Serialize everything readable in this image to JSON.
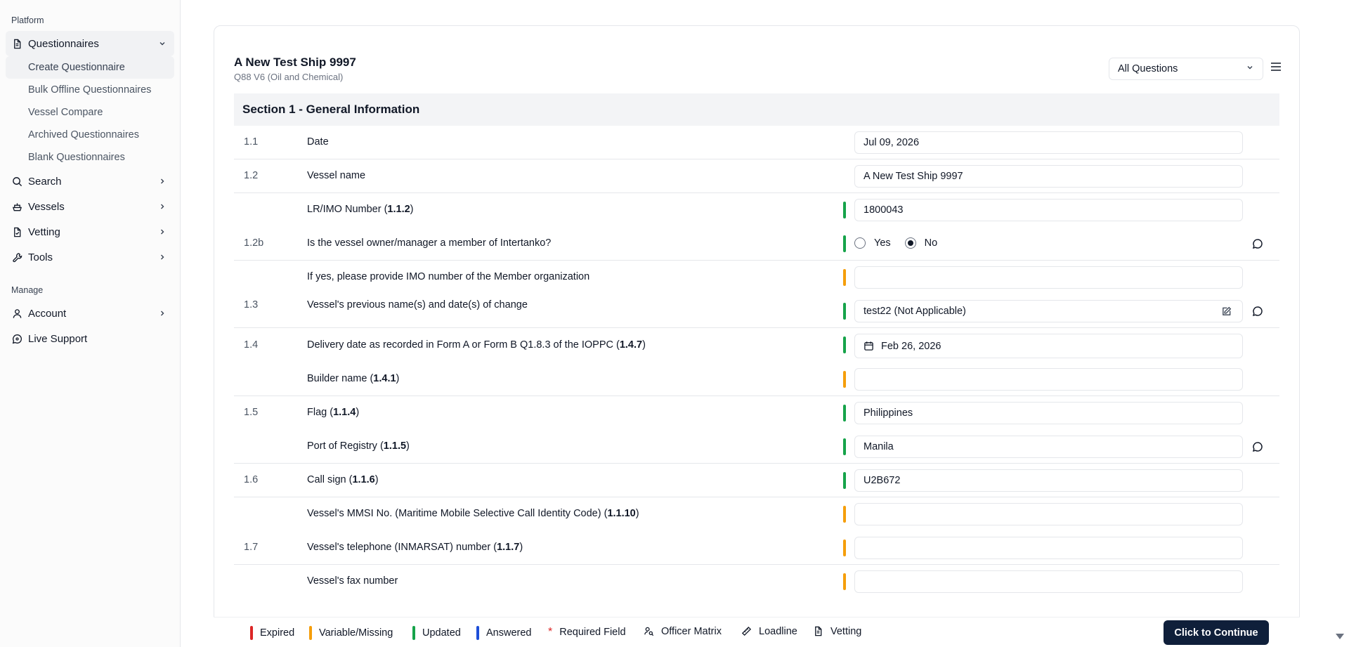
{
  "sidebar": {
    "platform_label": "Platform",
    "questionnaires_label": "Questionnaires",
    "sub_items": [
      "Create Questionnaire",
      "Bulk Offline Questionnaires",
      "Vessel Compare",
      "Archived Questionnaires",
      "Blank Questionnaires"
    ],
    "search_label": "Search",
    "vessels_label": "Vessels",
    "vetting_label": "Vetting",
    "tools_label": "Tools",
    "manage_label": "Manage",
    "account_label": "Account",
    "support_label": "Live Support"
  },
  "header": {
    "title": "A New Test Ship 9997",
    "subtitle": "Q88 V6 (Oil and Chemical)",
    "filter_value": "All Questions"
  },
  "section": {
    "title": "Section 1 - General Information"
  },
  "rows": {
    "r1": {
      "num": "1.1",
      "label": "Date",
      "value": "Jul 09, 2026"
    },
    "r2": {
      "num": "1.2",
      "label": "Vessel name",
      "value": "A New Test Ship 9997"
    },
    "r3": {
      "label": "LR/IMO Number (",
      "ref": "1.1.2",
      "close": ")",
      "value": "1800043"
    },
    "r4": {
      "num": "1.2b",
      "label": "Is the vessel owner/manager a member of Intertanko?",
      "yes": "Yes",
      "no": "No",
      "selected": "No"
    },
    "r5": {
      "label": "If yes, please provide IMO number of the Member organization",
      "value": ""
    },
    "r6": {
      "num": "1.3",
      "label": "Vessel's previous name(s) and date(s) of change",
      "value": "test22 (Not Applicable)"
    },
    "r7": {
      "num": "1.4",
      "label": "Delivery date as recorded in Form A or Form B Q1.8.3 of the IOPPC (",
      "ref": "1.4.7",
      "close": ")",
      "value": "Feb 26, 2026"
    },
    "r8": {
      "label": "Builder name (",
      "ref": "1.4.1",
      "close": ")",
      "value": ""
    },
    "r9": {
      "num": "1.5",
      "label": "Flag (",
      "ref": "1.1.4",
      "close": ")",
      "value": "Philippines"
    },
    "r10": {
      "label": "Port of Registry (",
      "ref": "1.1.5",
      "close": ")",
      "value": "Manila"
    },
    "r11": {
      "num": "1.6",
      "label": "Call sign (",
      "ref": "1.1.6",
      "close": ")",
      "value": "U2B672"
    },
    "r12": {
      "label": "Vessel's MMSI No. (Maritime Mobile Selective Call Identity Code) (",
      "ref": "1.1.10",
      "close": ")",
      "value": ""
    },
    "r13": {
      "num": "1.7",
      "label": "Vessel's telephone (INMARSAT) number (",
      "ref": "1.1.7",
      "close": ")",
      "value": ""
    },
    "r14": {
      "label": "Vessel's fax number",
      "value": ""
    }
  },
  "legend": {
    "expired": "Expired",
    "missing": "Variable/Missing",
    "updated": "Updated",
    "answered": "Answered",
    "required": "Required Field",
    "officer": "Officer Matrix",
    "loadline": "Loadline",
    "vetting": "Vetting",
    "continue": "Click to Continue"
  },
  "colors": {
    "expired": "#dc2626",
    "missing": "#f59e0b",
    "updated": "#16a34a",
    "answered": "#1d4ed8",
    "continue_bg": "#0f1f3a"
  }
}
